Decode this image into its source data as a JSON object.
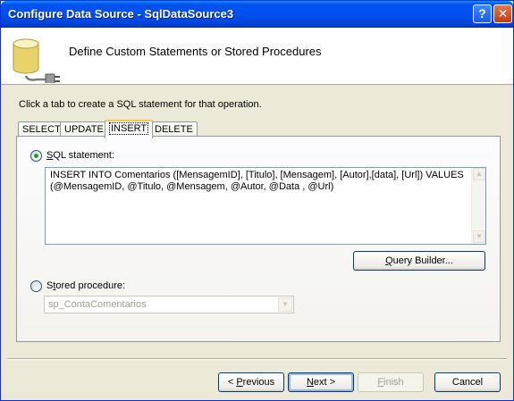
{
  "window": {
    "title": "Configure Data Source - SqlDataSource3",
    "help_glyph": "?",
    "close_glyph": "✕"
  },
  "header": {
    "title": "Define Custom Statements or Stored Procedures",
    "icon": "database-plug-icon"
  },
  "instruction": "Click a tab to create a SQL statement for that operation.",
  "tabs": [
    {
      "label": "SELECT",
      "active": false
    },
    {
      "label": "UPDATE",
      "active": false
    },
    {
      "label": "INSERT",
      "active": true
    },
    {
      "label": "DELETE",
      "active": false
    }
  ],
  "sql_option": {
    "label_accel": "S",
    "label_rest": "QL statement:",
    "selected": true,
    "value": "INSERT INTO Comentarios ([MensagemID], [Titulo], [Mensagem], [Autor],[data], [Url]) VALUES (@MensagemID, @Titulo, @Mensagem, @Autor, @Data , @Url)"
  },
  "query_builder": {
    "label_accel": "Q",
    "label_rest": "uery Builder..."
  },
  "sp_option": {
    "label_accel": "t",
    "label_pre": "S",
    "label_rest": "ored procedure:",
    "selected": false,
    "selected_value": "sp_ContaComentarios"
  },
  "footer": {
    "previous": {
      "pre": "< ",
      "accel": "P",
      "rest": "revious"
    },
    "next": {
      "accel": "N",
      "rest": "ext >"
    },
    "finish": {
      "accel": "F",
      "rest": "inish"
    },
    "cancel": "Cancel"
  }
}
